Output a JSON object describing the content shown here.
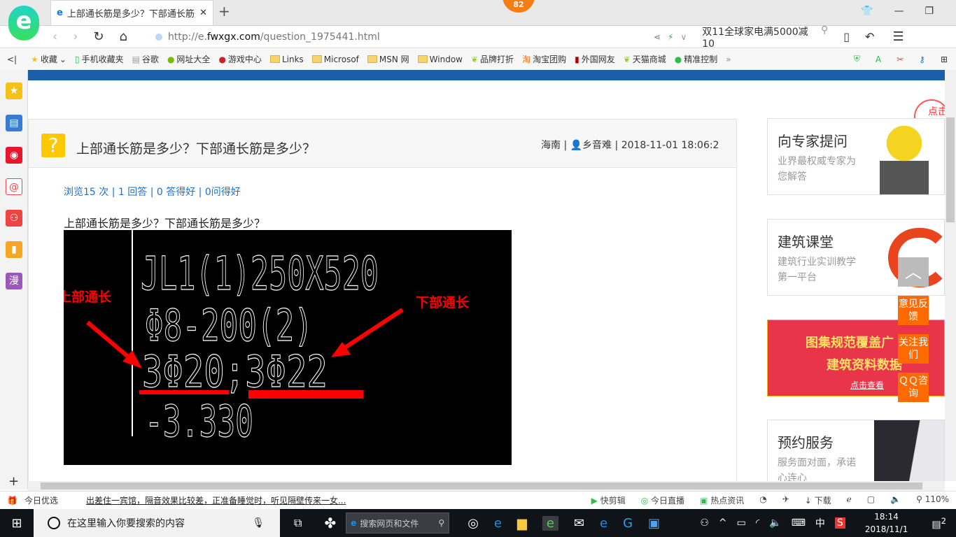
{
  "browser": {
    "tab_title": "上部通长筋是多少？下部通长筋是多少？",
    "badge": "82",
    "url_prefix": "http://e.",
    "url_domain": "fwxgx.com",
    "url_path": "/question_1975441.html",
    "search_text": "双11全球家电满5000减10"
  },
  "bookmarks": [
    "收藏",
    "手机收藏夹",
    "谷歌",
    "网址大全",
    "游戏中心",
    "Links",
    "Microsof",
    "MSN 网",
    "Window",
    "品牌打折",
    "淘宝团购",
    "外国网友",
    "天猫商城",
    "精准控制"
  ],
  "question": {
    "title": "上部通长筋是多少？下部通长筋是多少？",
    "region": "海南",
    "user": "乡音难",
    "time": "2018-11-01 18:06:2",
    "stats": [
      "浏览15 次",
      "1 回答",
      "0 答得好",
      "0问得好"
    ],
    "body": "上部通长筋是多少？下部通长筋是多少？"
  },
  "drawing": {
    "lines": [
      "JL1(1)250X520",
      "Φ8-200(2)",
      "3Φ20;3Φ22",
      "-3.330"
    ],
    "label_top": "上部通长",
    "label_bottom": "下部通长"
  },
  "sidebar_cards": [
    {
      "title": "向专家提问",
      "sub": "业界最权威专家为您解答",
      "bubble": "点击提问"
    },
    {
      "title": "建筑课堂",
      "sub": "建筑行业实训教学第一平台"
    },
    {
      "banner1": "图集规范覆盖广",
      "banner2": "建筑资料数据",
      "link": "点击查看"
    },
    {
      "title": "预约服务",
      "sub": "服务面对面，承诺心连心"
    }
  ],
  "float_buttons": [
    "意见反馈",
    "关注我们",
    "ＱＱ咨询"
  ],
  "status": {
    "left": "今日优选",
    "news": "出差住一宾馆，隔音效果比较差，正准备睡觉时，听见隔壁传来一女...",
    "items": [
      "快剪辑",
      "今日直播",
      "热点资讯",
      "下载"
    ],
    "zoom": "110%"
  },
  "taskbar": {
    "search_placeholder": "在这里输入你要搜索的内容",
    "browser_search": "搜索网页和文件",
    "ime": "中",
    "time": "18:14",
    "date": "2018/11/1",
    "notif": "2"
  },
  "colors": {
    "accent": "#1c5ea8",
    "orange": "#ff6a00",
    "red": "#ff0000"
  }
}
